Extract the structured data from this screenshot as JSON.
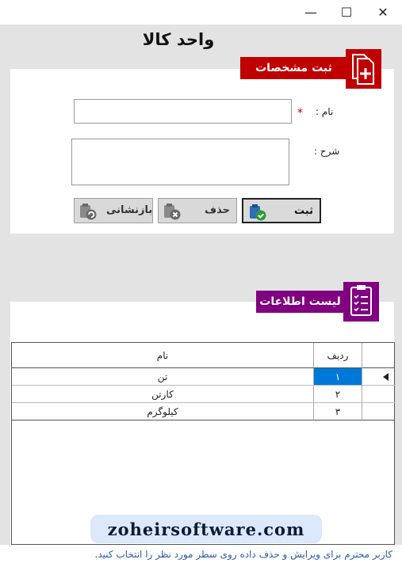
{
  "window": {
    "minimize_glyph": "—",
    "maximize_glyph": "☐",
    "close_glyph": "✕"
  },
  "page": {
    "title": "واحد کالا"
  },
  "form_panel": {
    "header": "ثبت مشخصات",
    "header_color": "#c00000",
    "name_label": "نام :",
    "required_mark": "*",
    "description_label": "شرح :",
    "name_value": "",
    "description_value": ""
  },
  "buttons": {
    "save": "ثبت",
    "delete": "حذف",
    "reset": "بازنشانی"
  },
  "list_panel": {
    "header": "لیست اطلاعات",
    "header_color": "#800080"
  },
  "table": {
    "columns": [
      "ردیف",
      "نام"
    ],
    "rows": [
      {
        "index": "۱",
        "name": "تن"
      },
      {
        "index": "۲",
        "name": "کارتن"
      },
      {
        "index": "۳",
        "name": "کیلوگرم"
      }
    ]
  },
  "watermark": "zoheirsoftware.com",
  "status_hint": "کاربر محترم برای ویرایش و حذف داده روی سطر مورد نظر را انتخاب کنید."
}
